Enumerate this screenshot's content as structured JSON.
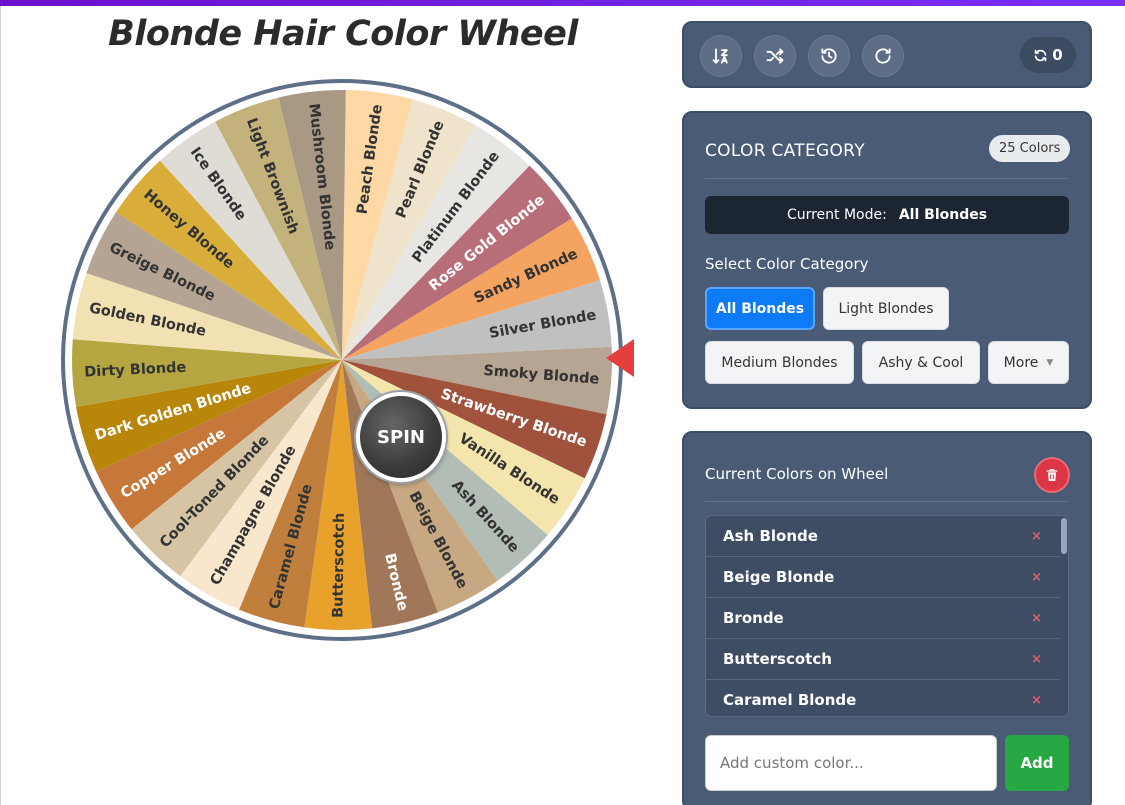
{
  "title": "Blonde Hair Color Wheel",
  "wheel": {
    "spin_label": "SPIN",
    "segments": [
      {
        "label": "Peach Blonde",
        "color": "#fdd8a5",
        "text_color": "#333333"
      },
      {
        "label": "Pearl Blonde",
        "color": "#efe3cb",
        "text_color": "#333333"
      },
      {
        "label": "Platinum Blonde",
        "color": "#e8e6e2",
        "text_color": "#333333"
      },
      {
        "label": "Rose Gold Blonde",
        "color": "#b76e79",
        "text_color": "#ffffff"
      },
      {
        "label": "Sandy Blonde",
        "color": "#f4a460",
        "text_color": "#333333"
      },
      {
        "label": "Silver Blonde",
        "color": "#c0c0c0",
        "text_color": "#333333"
      },
      {
        "label": "Smoky Blonde",
        "color": "#b6a592",
        "text_color": "#333333"
      },
      {
        "label": "Strawberry Blonde",
        "color": "#a0523d",
        "text_color": "#ffffff"
      },
      {
        "label": "Vanilla Blonde",
        "color": "#f3e5ab",
        "text_color": "#333333"
      },
      {
        "label": "Ash Blonde",
        "color": "#b2beb5",
        "text_color": "#333333"
      },
      {
        "label": "Beige Blonde",
        "color": "#c8a882",
        "text_color": "#333333"
      },
      {
        "label": "Bronde",
        "color": "#a07859",
        "text_color": "#ffffff"
      },
      {
        "label": "Butterscotch",
        "color": "#e8a22c",
        "text_color": "#333333"
      },
      {
        "label": "Caramel Blonde",
        "color": "#c17f3e",
        "text_color": "#333333"
      },
      {
        "label": "Champagne Blonde",
        "color": "#f8e7cc",
        "text_color": "#333333"
      },
      {
        "label": "Cool-Toned Blonde",
        "color": "#d6c4a5",
        "text_color": "#333333"
      },
      {
        "label": "Copper Blonde",
        "color": "#c6783a",
        "text_color": "#ffffff"
      },
      {
        "label": "Dark Golden Blonde",
        "color": "#b8860b",
        "text_color": "#ffffff"
      },
      {
        "label": "Dirty Blonde",
        "color": "#b5a642",
        "text_color": "#333333"
      },
      {
        "label": "Golden Blonde",
        "color": "#f2e2b3",
        "text_color": "#333333"
      },
      {
        "label": "Greige Blonde",
        "color": "#b5a493",
        "text_color": "#333333"
      },
      {
        "label": "Honey Blonde",
        "color": "#d9ad3a",
        "text_color": "#333333"
      },
      {
        "label": "Ice Blonde",
        "color": "#dfdcd6",
        "text_color": "#333333"
      },
      {
        "label": "Light Brownish",
        "color": "#c4b27c",
        "text_color": "#333333"
      },
      {
        "label": "Mushroom Blonde",
        "color": "#a89884",
        "text_color": "#333333"
      }
    ]
  },
  "toolbar": {
    "sort_icon": "sort-icon",
    "shuffle_icon": "shuffle-icon",
    "history_icon": "history-icon",
    "redo_icon": "redo-icon",
    "spin_count": "0"
  },
  "category": {
    "heading": "COLOR CATEGORY",
    "badge": "25 Colors",
    "mode_label": "Current Mode:",
    "mode_value": "All Blondes",
    "select_label": "Select Color Category",
    "buttons": [
      "All Blondes",
      "Light Blondes",
      "Medium Blondes",
      "Ashy & Cool",
      "More"
    ]
  },
  "colors_list": {
    "heading": "Current Colors on Wheel",
    "remove_symbol": "×",
    "items": [
      "Ash Blonde",
      "Beige Blonde",
      "Bronde",
      "Butterscotch",
      "Caramel Blonde"
    ],
    "input_placeholder": "Add custom color...",
    "add_label": "Add"
  }
}
